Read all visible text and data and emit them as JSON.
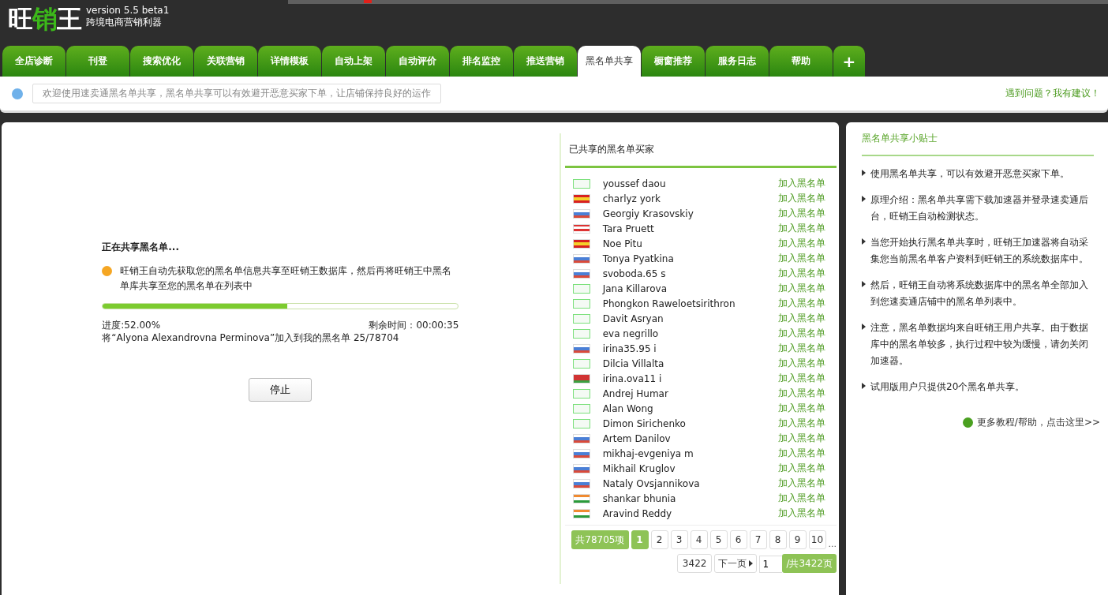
{
  "app": {
    "logo": [
      {
        "text": "旺",
        "accent": false
      },
      {
        "text": "销",
        "accent": true
      },
      {
        "text": "王",
        "accent": false
      }
    ],
    "version": "version 5.5 beta1",
    "tagline": "跨境电商营销利器"
  },
  "tabs": [
    {
      "label": "全店诊断",
      "selected": false
    },
    {
      "label": "刊登",
      "selected": false
    },
    {
      "label": "搜索优化",
      "selected": false
    },
    {
      "label": "关联营销",
      "selected": false
    },
    {
      "label": "详情模板",
      "selected": false
    },
    {
      "label": "自动上架",
      "selected": false
    },
    {
      "label": "自动评价",
      "selected": false
    },
    {
      "label": "排名监控",
      "selected": false
    },
    {
      "label": "推送营销",
      "selected": false
    },
    {
      "label": "黑名单共享",
      "selected": true
    },
    {
      "label": "橱窗推荐",
      "selected": false
    },
    {
      "label": "服务日志",
      "selected": false
    },
    {
      "label": "帮助",
      "selected": false
    }
  ],
  "add_tab": "+",
  "notice": {
    "text": "欢迎使用速卖通黑名单共享，黑名单共享可以有效避开恶意买家下单，让店铺保持良好的运作",
    "feedback_link": "遇到问题？我有建议！"
  },
  "progress": {
    "title": "正在共享黑名单...",
    "message": "旺销王自动先获取您的黑名单信息共享至旺销王数据库，然后再将旺销王中黑名单库共享至您的黑名单在列表中",
    "level": 0.52,
    "percent": "进度:52.00%",
    "remaining": "剩余时间：00:00:35",
    "status": "将“Alyona Alexandrovna Perminova”加入到我的黑名单 25/78704",
    "stop_button": "停止"
  },
  "shared_list": {
    "title": "已共享的黑名单买家",
    "rows": [
      {
        "kind": "blank",
        "name": "youssef daou",
        "action": "加入黑名单"
      },
      {
        "kind": "es",
        "name": "charlyz york",
        "action": "加入黑名单"
      },
      {
        "kind": "ru",
        "name": "Georgiy Krasovskiy",
        "action": "加入黑名单"
      },
      {
        "kind": "us",
        "name": "Tara Pruett",
        "action": "加入黑名单"
      },
      {
        "kind": "es",
        "name": "Noe Pitu",
        "action": "加入黑名单"
      },
      {
        "kind": "ru",
        "name": "Tonya Pyatkina",
        "action": "加入黑名单"
      },
      {
        "kind": "ru",
        "name": "svoboda.65 s",
        "action": "加入黑名单"
      },
      {
        "kind": "blank",
        "name": "Jana Killarova",
        "action": "加入黑名单"
      },
      {
        "kind": "blank",
        "name": "Phongkon Raweloetsirithron",
        "action": "加入黑名单"
      },
      {
        "kind": "blank",
        "name": "Davit Asryan",
        "action": "加入黑名单"
      },
      {
        "kind": "blank",
        "name": "eva negrillo",
        "action": "加入黑名单"
      },
      {
        "kind": "ru",
        "name": "irina35.95 i",
        "action": "加入黑名单"
      },
      {
        "kind": "blank",
        "name": "Dilcia Villalta",
        "action": "加入黑名单"
      },
      {
        "kind": "by",
        "name": "irina.ova11 i",
        "action": "加入黑名单"
      },
      {
        "kind": "blank",
        "name": "Andrej Humar",
        "action": "加入黑名单"
      },
      {
        "kind": "blank",
        "name": "Alan Wong",
        "action": "加入黑名单"
      },
      {
        "kind": "blank",
        "name": "Dimon Sirichenko",
        "action": "加入黑名单"
      },
      {
        "kind": "ru",
        "name": "Artem Danilov",
        "action": "加入黑名单"
      },
      {
        "kind": "ru",
        "name": "mikhaj-evgeniya m",
        "action": "加入黑名单"
      },
      {
        "kind": "ru",
        "name": "Mikhail Kruglov",
        "action": "加入黑名单"
      },
      {
        "kind": "ru",
        "name": "Nataly Ovsjannikova",
        "action": "加入黑名单"
      },
      {
        "kind": "in",
        "name": "shankar bhunia",
        "action": "加入黑名单"
      },
      {
        "kind": "in",
        "name": "Aravind Reddy",
        "action": "加入黑名单"
      }
    ],
    "pagination": {
      "total": "共78705项",
      "pages": [
        {
          "label": "1",
          "selected": true
        },
        {
          "label": "2",
          "selected": false
        },
        {
          "label": "3",
          "selected": false
        },
        {
          "label": "4",
          "selected": false
        },
        {
          "label": "5",
          "selected": false
        },
        {
          "label": "6",
          "selected": false
        },
        {
          "label": "7",
          "selected": false
        },
        {
          "label": "8",
          "selected": false
        },
        {
          "label": "9",
          "selected": false
        },
        {
          "label": "10",
          "selected": false
        }
      ],
      "ellipsis": "...",
      "last_page": "3422",
      "next": "下一页",
      "page_input": "1",
      "page_count": "/共3422页"
    }
  },
  "tips": {
    "title": "黑名单共享小贴士",
    "items": [
      "使用黑名单共享，可以有效避开恶意买家下单。",
      "原理介绍：黑名单共享需下载加速器并登录速卖通后台，旺销王自动检测状态。",
      "当您开始执行黑名单共享时，旺销王加速器将自动采集您当前黑名单客户资料到旺销王的系统数据库中。",
      "然后，旺销王自动将系统数据库中的黑名单全部加入到您速卖通店铺中的黑名单列表中。",
      "注意，黑名单数据均来自旺销王用户共享。由于数据库中的黑名单较多，执行过程中较为缓慢，请勿关闭加速器。",
      "试用版用户只提供20个黑名单共享。"
    ],
    "help_link": "更多教程/帮助，点击这里>>"
  }
}
